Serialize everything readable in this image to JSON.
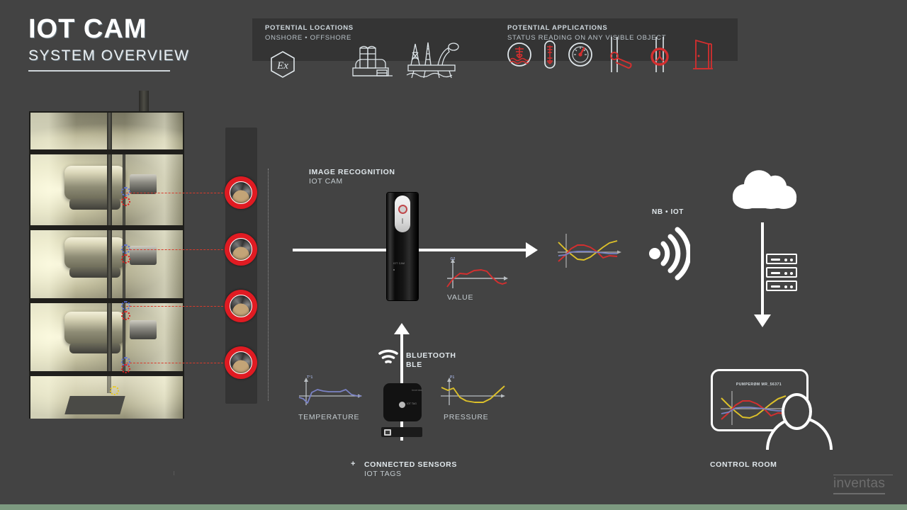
{
  "title": {
    "main": "IOT CAM",
    "sub": "SYSTEM OVERVIEW"
  },
  "banner": {
    "locations": {
      "heading": "POTENTIAL LOCATIONS",
      "subheading": "ONSHORE • OFFSHORE",
      "icons": [
        "atex-ex-hexagon-icon",
        "onshore-plant-icon",
        "offshore-rig-icon"
      ]
    },
    "applications": {
      "heading": "POTENTIAL APPLICATIONS",
      "subheading": "STATUS READING ON ANY VISIBLE OBJECT",
      "icons": [
        "level-gauge-icon",
        "sight-glass-icon",
        "pressure-dial-icon",
        "valve-icon",
        "manometer-icon",
        "door-icon"
      ]
    }
  },
  "flow": {
    "image_recognition_heading": "IMAGE RECOGNITION",
    "image_recognition_sub": "IOT CAM",
    "nb_iot_label": "NB • IOT",
    "bluetooth_label": "BLUETOOTH",
    "ble_label": "BLE",
    "connected_sensors_plus": "+",
    "connected_sensors_label": "CONNECTED SENSORS",
    "iot_tags_label": "IOT TAGS",
    "control_room_label": "CONTROL ROOM",
    "screen_label": "PUMPERØM MR_56371"
  },
  "device": {
    "body_text": "IOT CAM",
    "tag_text": "IOT TAG",
    "tag_logo": "inventas"
  },
  "colors": {
    "background": "#434343",
    "banner": "#343434",
    "accent_red": "#e01b22",
    "series_red": "#d42f2f",
    "series_yellow": "#dcc02a",
    "series_blue": "#7a82c4",
    "footer_green": "#7d9a80",
    "text_light": "#dfe6ea",
    "text_muted": "#b9c2c8",
    "logo_gray": "#6d6d6d"
  },
  "logo": {
    "text": "inventas"
  },
  "chart_data": [
    {
      "id": "value-chart",
      "type": "line",
      "title": "VALUE",
      "ylabel": "G2",
      "xlabel": "",
      "grid": false,
      "legend": "none",
      "series": [
        {
          "name": "G2",
          "color": "#d42f2f",
          "x": [
            0,
            8,
            16,
            24,
            32,
            40,
            48,
            56,
            64,
            72,
            80
          ],
          "values": [
            -14,
            -2,
            7,
            6,
            11,
            12,
            10,
            2,
            -6,
            -9,
            -7
          ]
        }
      ],
      "ylim": [
        -18,
        16
      ],
      "xlim": [
        0,
        80
      ]
    },
    {
      "id": "combined-chart",
      "type": "line",
      "title": "",
      "ylabel": "",
      "xlabel": "",
      "grid": false,
      "legend": "none",
      "series": [
        {
          "name": "pressure",
          "color": "#dcc02a",
          "x": [
            0,
            10,
            20,
            30,
            40,
            50,
            60,
            70,
            80,
            90
          ],
          "values": [
            10,
            2,
            -3,
            -8,
            -9,
            -6,
            0,
            6,
            12,
            14
          ]
        },
        {
          "name": "value",
          "color": "#d42f2f",
          "x": [
            0,
            10,
            20,
            30,
            40,
            50,
            60,
            70,
            80,
            90
          ],
          "values": [
            -12,
            -4,
            5,
            9,
            9,
            7,
            1,
            -6,
            -3,
            -4
          ]
        },
        {
          "name": "temperature",
          "color": "#7a82c4",
          "x": [
            0,
            10,
            20,
            30,
            40,
            50,
            60,
            70,
            80,
            90
          ],
          "values": [
            -5,
            -4,
            0,
            1,
            1,
            1,
            0,
            -1,
            -2,
            -2
          ]
        }
      ],
      "ylim": [
        -16,
        16
      ],
      "xlim": [
        0,
        90
      ]
    },
    {
      "id": "temperature-chart",
      "type": "line",
      "title": "TEMPERATURE",
      "ylabel": "T°1",
      "xlabel": "",
      "grid": false,
      "legend": "none",
      "series": [
        {
          "name": "T°1",
          "color": "#7a82c4",
          "x": [
            0,
            6,
            12,
            18,
            24,
            32,
            40,
            48,
            56,
            64,
            72,
            80,
            88
          ],
          "values": [
            -3,
            -4,
            -9,
            2,
            5,
            4,
            3,
            3,
            3,
            5,
            1,
            0,
            0
          ]
        }
      ],
      "ylim": [
        -12,
        10
      ],
      "xlim": [
        0,
        88
      ]
    },
    {
      "id": "pressure-chart",
      "type": "line",
      "title": "PRESSURE",
      "ylabel": "P1",
      "xlabel": "",
      "grid": false,
      "legend": "none",
      "series": [
        {
          "name": "P1",
          "color": "#dcc02a",
          "x": [
            0,
            8,
            16,
            24,
            32,
            44,
            56,
            68,
            80,
            90
          ],
          "values": [
            9,
            6,
            8,
            -1,
            -6,
            -8,
            -8,
            -4,
            3,
            10
          ]
        }
      ],
      "ylim": [
        -12,
        12
      ],
      "xlim": [
        0,
        90
      ]
    },
    {
      "id": "control-room-chart",
      "type": "line",
      "title": "",
      "ylabel": "",
      "xlabel": "",
      "grid": false,
      "legend": "none",
      "series": [
        {
          "name": "pressure",
          "color": "#dcc02a",
          "x": [
            0,
            10,
            20,
            30,
            40,
            50,
            60,
            70,
            80,
            90
          ],
          "values": [
            11,
            3,
            -4,
            -9,
            -10,
            -7,
            -1,
            6,
            12,
            15
          ]
        },
        {
          "name": "value",
          "color": "#d42f2f",
          "x": [
            0,
            10,
            20,
            30,
            40,
            50,
            60,
            70,
            80,
            90
          ],
          "values": [
            -13,
            -4,
            6,
            10,
            10,
            7,
            1,
            -6,
            -3,
            -4
          ]
        },
        {
          "name": "temperature",
          "color": "#7a82c4",
          "x": [
            0,
            10,
            20,
            30,
            40,
            50,
            60,
            70,
            80,
            90
          ],
          "values": [
            -6,
            -4,
            1,
            2,
            2,
            1,
            0,
            -1,
            -2,
            -2
          ]
        }
      ],
      "ylim": [
        -16,
        17
      ],
      "xlim": [
        0,
        90
      ]
    }
  ]
}
